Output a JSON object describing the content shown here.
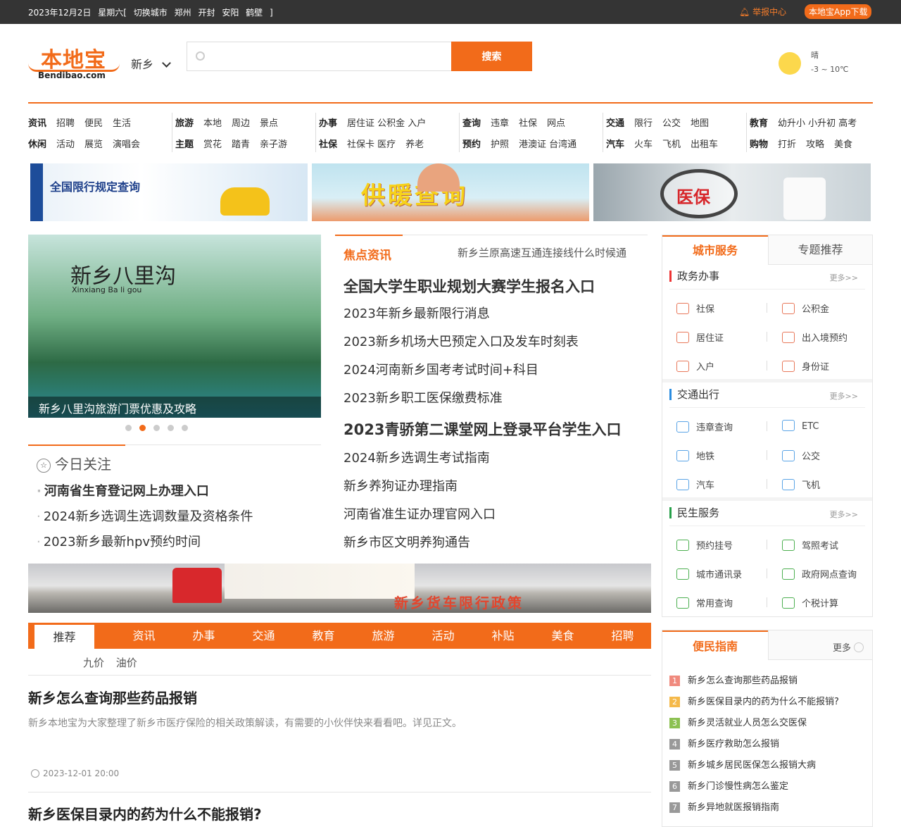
{
  "topbar": {
    "date": "2023年12月2日",
    "weekday": "星期六[",
    "switch_city": "切换城市",
    "cities": [
      "郑州",
      "开封",
      "安阳",
      "鹤壁",
      "]"
    ],
    "report": "举报中心",
    "app": "本地宝App下载"
  },
  "header": {
    "logo_cn": "本地宝",
    "logo_en": "Bendibao.com",
    "city": "新乡",
    "search_placeholder": "",
    "search_button": "搜索",
    "weather_cond": "晴",
    "weather_temp": "-3 ~ 10℃"
  },
  "nav": [
    {
      "row1": [
        {
          "t": "资讯",
          "b": true
        },
        {
          "t": "招聘"
        },
        {
          "t": "便民"
        },
        {
          "t": "生活"
        }
      ],
      "row2": [
        {
          "t": "休闲",
          "b": true
        },
        {
          "t": "活动"
        },
        {
          "t": "展览"
        },
        {
          "t": "演唱会"
        }
      ]
    },
    {
      "row1": [
        {
          "t": "旅游",
          "b": true
        },
        {
          "t": "本地"
        },
        {
          "t": "周边"
        },
        {
          "t": "景点"
        }
      ],
      "row2": [
        {
          "t": "主题",
          "b": true
        },
        {
          "t": "赏花"
        },
        {
          "t": "踏青"
        },
        {
          "t": "亲子游"
        }
      ]
    },
    {
      "row1": [
        {
          "t": "办事",
          "b": true
        },
        {
          "t": "居住证 公积金 入户"
        }
      ],
      "row2": [
        {
          "t": "社保",
          "b": true
        },
        {
          "t": "社保卡 医疗"
        },
        {
          "t": "养老"
        }
      ]
    },
    {
      "row1": [
        {
          "t": "查询",
          "b": true
        },
        {
          "t": "违章"
        },
        {
          "t": "社保"
        },
        {
          "t": "网点"
        }
      ],
      "row2": [
        {
          "t": "预约",
          "b": true
        },
        {
          "t": "护照"
        },
        {
          "t": "港澳证 台湾通"
        }
      ]
    },
    {
      "row1": [
        {
          "t": "交通",
          "b": true
        },
        {
          "t": "限行"
        },
        {
          "t": "公交"
        },
        {
          "t": "地图"
        }
      ],
      "row2": [
        {
          "t": "汽车",
          "b": true
        },
        {
          "t": "火车"
        },
        {
          "t": "飞机"
        },
        {
          "t": "出租车"
        }
      ]
    },
    {
      "row1": [
        {
          "t": "教育",
          "b": true
        },
        {
          "t": "幼升小 小升初 高考"
        }
      ],
      "row2": [
        {
          "t": "购物",
          "b": true
        },
        {
          "t": "打折"
        },
        {
          "t": "攻略"
        },
        {
          "t": "美食"
        }
      ]
    }
  ],
  "banners": {
    "b1": "全国限行规定查询",
    "b2": "供暖查询",
    "b3": "医保"
  },
  "carousel": {
    "title": "新乡八里沟",
    "subtitle": "Xinxiang Ba li gou",
    "caption": "新乡八里沟旅游门票优惠及攻略",
    "dots": 5,
    "active": 1
  },
  "today": {
    "title": "今日关注",
    "items": [
      "河南省生育登记网上办理入口",
      "2024新乡选调生选调数量及资格条件",
      "2023新乡最新hpv预约时间"
    ]
  },
  "focus": {
    "title": "焦点资讯",
    "ticker": "新乡兰原高速互通连接线什么时候通",
    "items": [
      {
        "t": "全国大学生职业规划大赛学生报名入口",
        "h": true
      },
      {
        "t": "2023年新乡最新限行消息"
      },
      {
        "t": "2023新乡机场大巴预定入口及发车时刻表"
      },
      {
        "t": "2024河南新乡国考考试时间+科目"
      },
      {
        "t": "2023新乡职工医保缴费标准"
      },
      {
        "t": "2023青骄第二课堂网上登录平台学生入口",
        "h2": true
      },
      {
        "t": "2024新乡选调生考试指南"
      },
      {
        "t": "新乡养狗证办理指南"
      },
      {
        "t": "河南省准生证办理官网入口"
      },
      {
        "t": "新乡市区文明养狗通告"
      }
    ]
  },
  "truck_banner": "新乡货车限行政策",
  "tabs": [
    "推荐",
    "资讯",
    "办事",
    "交通",
    "教育",
    "旅游",
    "活动",
    "补贴",
    "美食",
    "招聘"
  ],
  "subtabs": [
    "九价",
    "油价"
  ],
  "articles": [
    {
      "title": "新乡怎么查询那些药品报销",
      "desc": "新乡本地宝为大家整理了新乡市医疗保险的相关政策解读，有需要的小伙伴快来看看吧。详见正文。",
      "time": "2023-12-01 20:00"
    },
    {
      "title": "新乡医保目录内的药为什么不能报销?"
    }
  ],
  "services": {
    "tab1": "城市服务",
    "tab2": "专题推荐",
    "sections": [
      {
        "title": "政务办事",
        "more": "更多>>",
        "color": "#e33",
        "items": [
          "社保",
          "公积金",
          "居住证",
          "出入境预约",
          "入户",
          "身份证"
        ]
      },
      {
        "title": "交通出行",
        "more": "更多>>",
        "color": "#2a8ce0",
        "items": [
          "违章查询",
          "ETC",
          "地铁",
          "公交",
          "汽车",
          "飞机"
        ]
      },
      {
        "title": "民生服务",
        "more": "更多>>",
        "color": "#27a04a",
        "items": [
          "预约挂号",
          "驾照考试",
          "城市通讯录",
          "政府网点查询",
          "常用查询",
          "个税计算"
        ]
      }
    ]
  },
  "guide": {
    "title": "便民指南",
    "more": "更多",
    "items": [
      {
        "n": "1",
        "t": "新乡怎么查询那些药品报销",
        "c": "#f08a7e"
      },
      {
        "n": "2",
        "t": "新乡医保目录内的药为什么不能报销?",
        "c": "#f5b94a"
      },
      {
        "n": "3",
        "t": "新乡灵活就业人员怎么交医保",
        "c": "#8cc152"
      },
      {
        "n": "4",
        "t": "新乡医疗救助怎么报销",
        "c": "#999999"
      },
      {
        "n": "5",
        "t": "新乡城乡居民医保怎么报销大病",
        "c": "#999999"
      },
      {
        "n": "6",
        "t": "新乡门诊慢性病怎么鉴定",
        "c": "#999999"
      },
      {
        "n": "7",
        "t": "新乡异地就医报销指南",
        "c": "#999999"
      }
    ]
  }
}
